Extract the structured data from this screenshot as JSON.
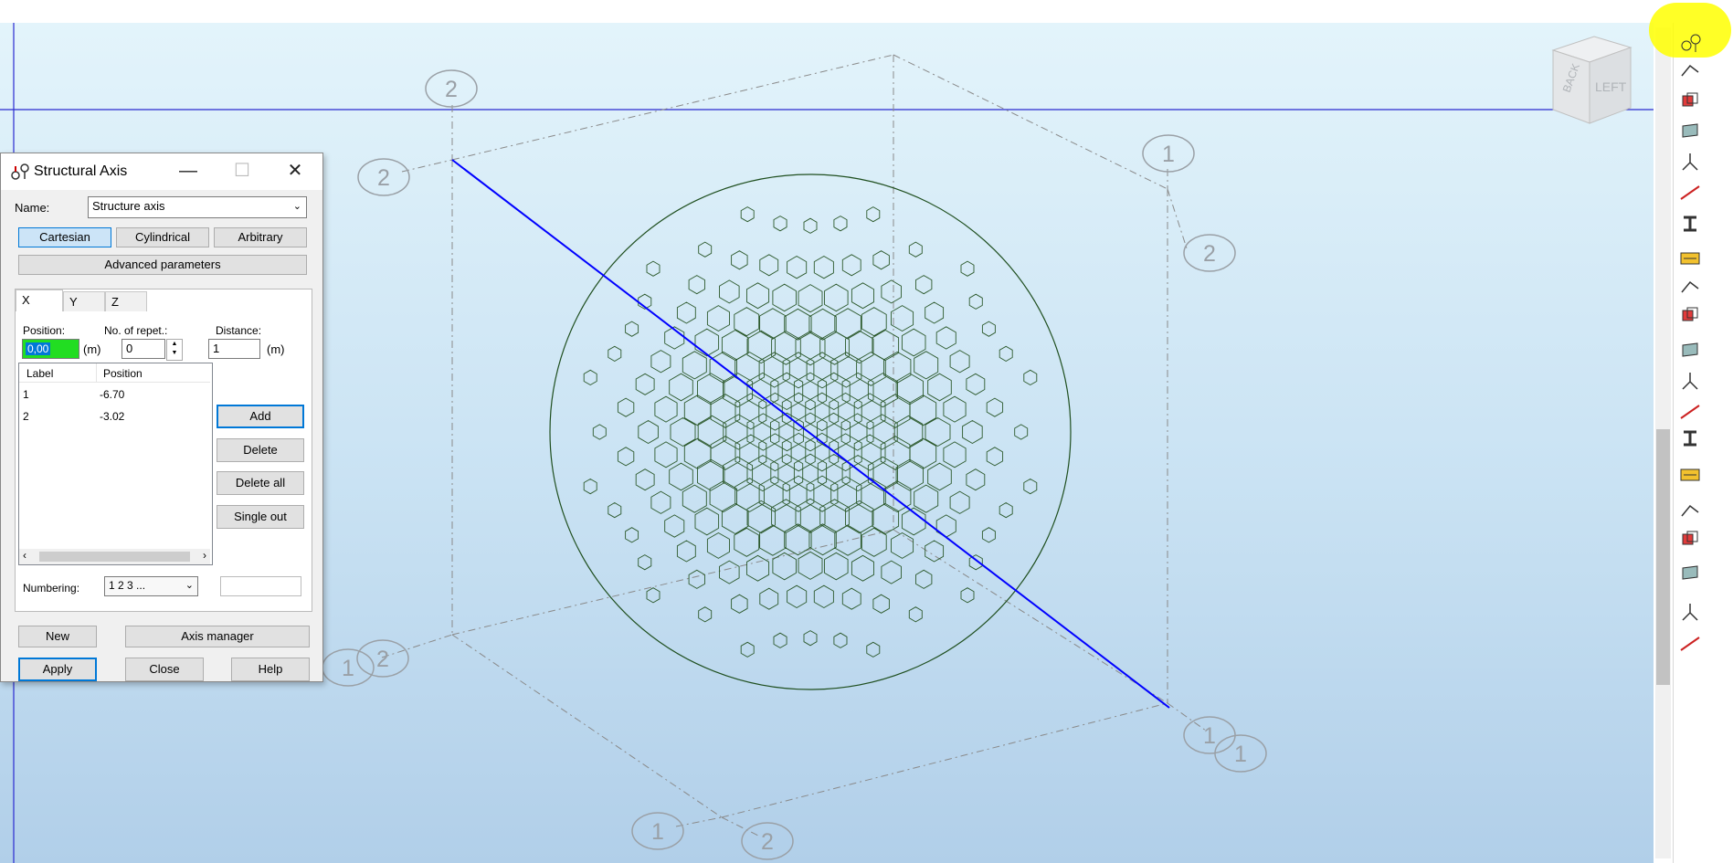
{
  "viewport": {
    "axis_labels": [
      "2",
      "2",
      "1",
      "2",
      "2",
      "1",
      "1",
      "1",
      "1",
      "2"
    ],
    "view_cube": {
      "back": "BACK",
      "left": "LEFT"
    }
  },
  "toolbar": {
    "icons": [
      "structural-axis-icon",
      "bar-icon",
      "line-icon",
      "node-icon",
      "panel-icon",
      "support-icon",
      "member-icon",
      "slab-icon",
      "release-icon",
      "offset-icon",
      "section-icon",
      "material-icon",
      "cable-icon",
      "solid-icon",
      "load-icon",
      "beam-icon",
      "truss-icon",
      "frame-icon",
      "table-icon",
      "layer-icon"
    ],
    "highlight_color": "#ffff00"
  },
  "dialog": {
    "title": "Structural Axis",
    "name_label": "Name:",
    "name_value": "Structure axis",
    "coord_buttons": [
      "Cartesian",
      "Cylindrical",
      "Arbitrary"
    ],
    "selected_coord": "Cartesian",
    "advanced_label": "Advanced parameters",
    "tabs": [
      "X",
      "Y",
      "Z"
    ],
    "active_tab": "X",
    "position_label": "Position:",
    "position_value": "0,00",
    "position_unit": "(m)",
    "repeat_label": "No. of repet.:",
    "repeat_value": "0",
    "distance_label": "Distance:",
    "distance_value": "1",
    "distance_unit": "(m)",
    "list_headers": [
      "Label",
      "Position"
    ],
    "list_rows": [
      {
        "label": "1",
        "position": "-6.70"
      },
      {
        "label": "2",
        "position": "-3.02"
      }
    ],
    "buttons": {
      "add": "Add",
      "delete": "Delete",
      "delete_all": "Delete all",
      "single_out": "Single out"
    },
    "numbering_label": "Numbering:",
    "numbering_value": "1 2 3 ...",
    "numbering_extra": "",
    "new_label": "New",
    "axis_manager_label": "Axis manager",
    "apply_label": "Apply",
    "close_label": "Close",
    "help_label": "Help"
  }
}
